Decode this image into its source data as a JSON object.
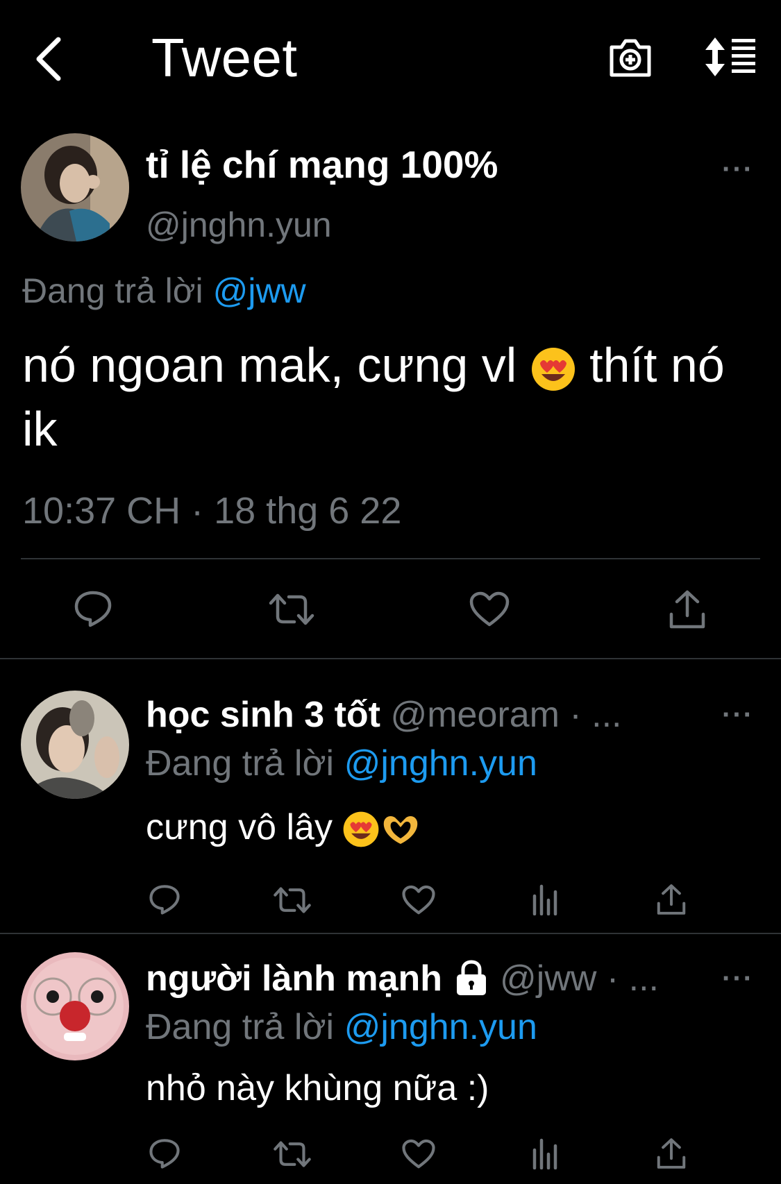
{
  "header": {
    "title": "Tweet",
    "back_icon": "chevron-left-icon",
    "camera_icon": "camera-plus-icon",
    "sort_icon": "sort-list-icon"
  },
  "main_tweet": {
    "name": "tỉ lệ chí mạng 100%",
    "handle": "@jnghn.yun",
    "replying_prefix": "Đang trả lời",
    "replying_to": "@jww",
    "text_part1": " nó ngoan mak, cưng vl ",
    "text_part2": " thít nó ik",
    "timestamp": "10:37 CH · 18 thg 6 22",
    "more": "···"
  },
  "replies": [
    {
      "name": "học sinh 3 tốt",
      "handle": "@meoram · ...",
      "replying_prefix": "Đang trả lời",
      "replying_to": "@jnghn.yun",
      "text": "cưng vô lây ",
      "more": "···"
    },
    {
      "name": "người lành mạnh",
      "handle": "@jww · ...",
      "replying_prefix": "Đang trả lời",
      "replying_to": "@jnghn.yun",
      "text": "nhỏ này khùng nữa :)",
      "more": "···"
    }
  ],
  "colors": {
    "background": "#000000",
    "text": "#ffffff",
    "muted": "#71767b",
    "link": "#1d9bf0",
    "divider": "#2f3336"
  }
}
